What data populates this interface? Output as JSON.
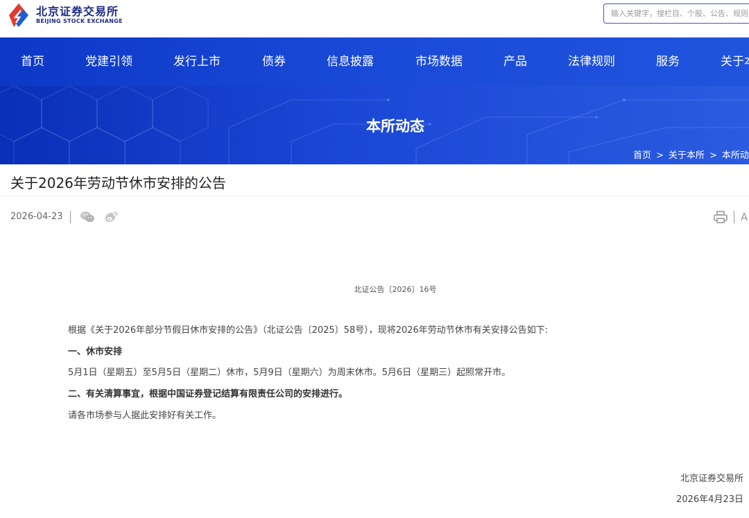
{
  "header": {
    "logo_cn": "北京证券交易所",
    "logo_en": "BEIJING STOCK EXCHANGE",
    "search_placeholder": "输入关键字，搜栏目、个股、公告、规则"
  },
  "nav": {
    "items": [
      "首页",
      "党建引领",
      "发行上市",
      "债券",
      "信息披露",
      "市场数据",
      "产品",
      "法律规则",
      "服务",
      "关于本所"
    ]
  },
  "banner": {
    "title": "本所动态",
    "breadcrumb": [
      "首页",
      "关于本所",
      "本所动态"
    ]
  },
  "article": {
    "title": "关于2026年劳动节休市安排的公告",
    "date": "2026-04-23",
    "font_toggle": "A",
    "doc_number": "北证公告〔2026〕16号",
    "paragraphs": [
      "根据《关于2026年部分节假日休市安排的公告》（北证公告〔2025〕58号），现将2026年劳动节休市有关安排公告如下:",
      "一、休市安排",
      "5月1日（星期五）至5月5日（星期二）休市，5月9日（星期六）为周末休市。5月6日（星期三）起照常开市。",
      "二、有关清算事宜，根据中国证券登记结算有限责任公司的安排进行。",
      "请各市场参与人据此安排好有关工作。"
    ],
    "signature_org": "北京证券交易所",
    "signature_date": "2026年4月23日"
  },
  "colors": {
    "brand_blue": "#1b2c86",
    "nav_blue": "#1a47d6",
    "logo_red": "#e23b2e",
    "logo_blue": "#1f5fd6"
  },
  "icons": [
    "logo-icon",
    "wechat-icon",
    "weibo-icon",
    "print-icon"
  ]
}
